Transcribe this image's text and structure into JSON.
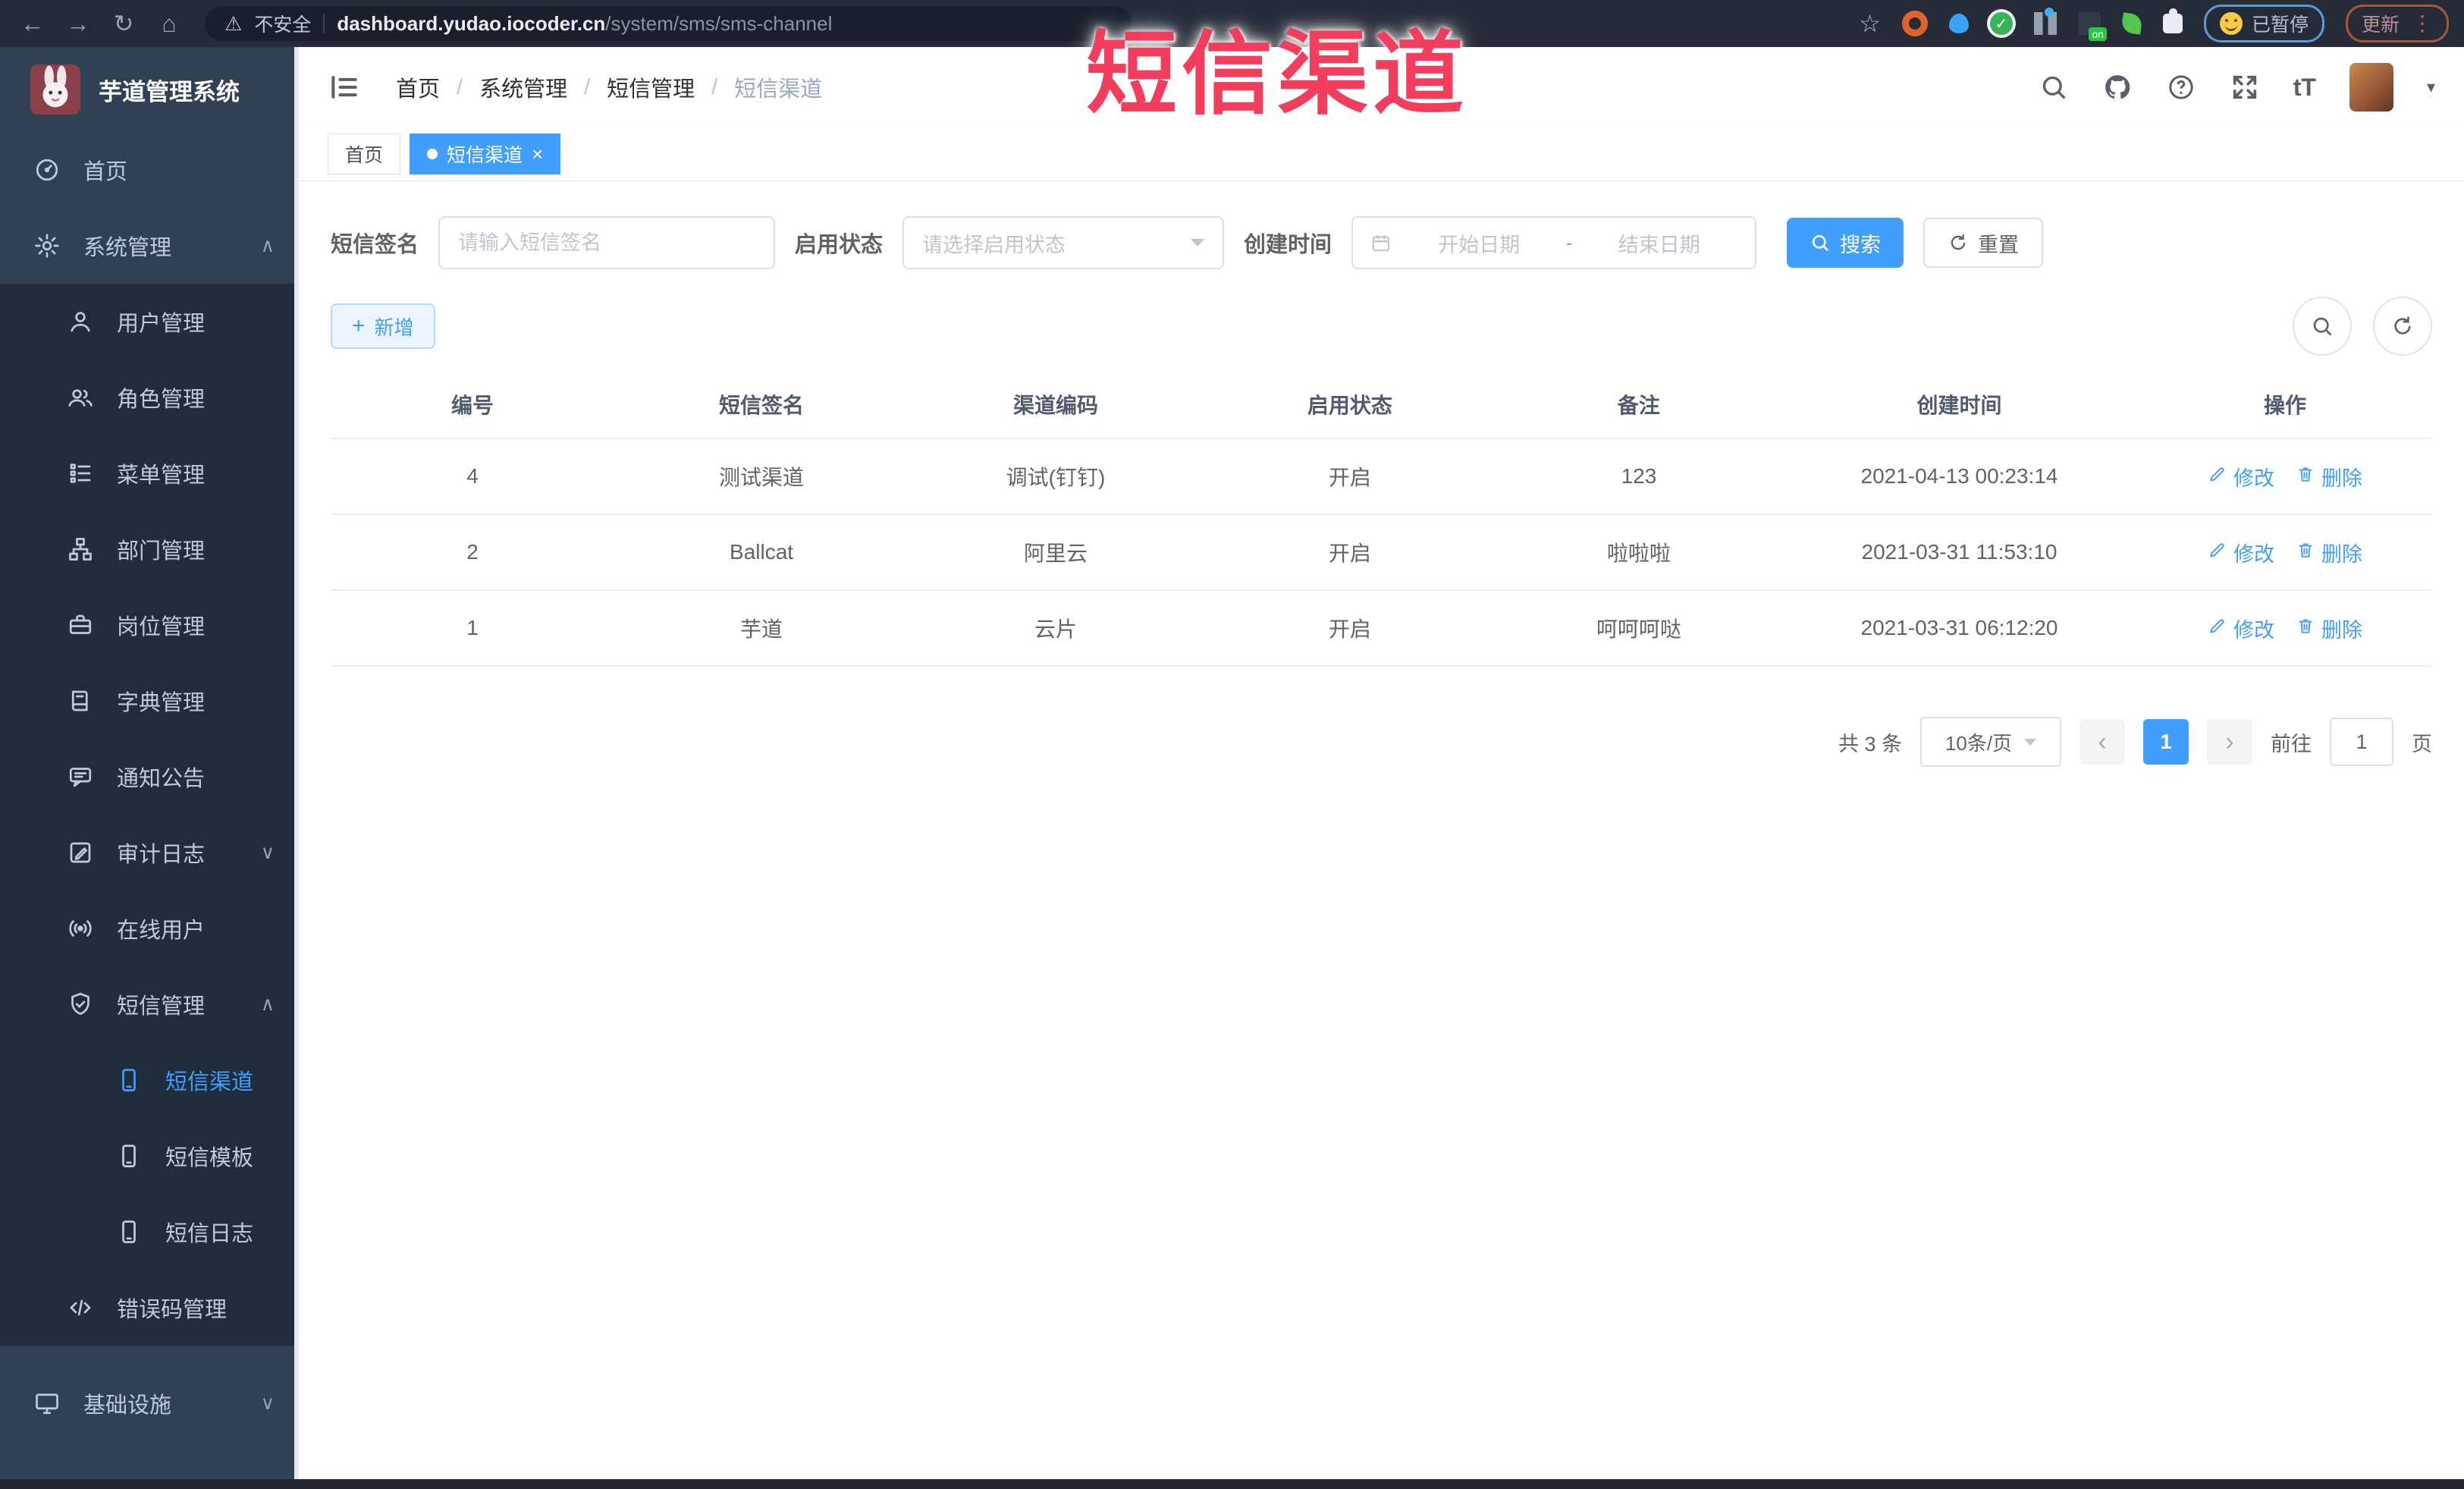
{
  "watermark": "短信渠道",
  "colors": {
    "accent": "#409eff",
    "watermark": "#f23e5c",
    "sidebar_bg": "#304156",
    "submenu_bg": "#1f2d3d"
  },
  "browser": {
    "security_label": "不安全",
    "url_host": "dashboard.yudao.iocoder.cn",
    "url_path": "/system/sms/sms-channel",
    "paused_label": "已暂停",
    "update_label": "更新"
  },
  "sidebar": {
    "app_title": "芋道管理系统",
    "items": [
      {
        "label": "首页",
        "icon": "dashboard-icon"
      },
      {
        "label": "系统管理",
        "icon": "gear-icon",
        "arrow": "up"
      },
      {
        "label": "用户管理",
        "icon": "user-icon",
        "sub": 1
      },
      {
        "label": "角色管理",
        "icon": "users-icon",
        "sub": 1
      },
      {
        "label": "菜单管理",
        "icon": "menu-list-icon",
        "sub": 1
      },
      {
        "label": "部门管理",
        "icon": "org-tree-icon",
        "sub": 1
      },
      {
        "label": "岗位管理",
        "icon": "briefcase-icon",
        "sub": 1
      },
      {
        "label": "字典管理",
        "icon": "dictionary-icon",
        "sub": 1
      },
      {
        "label": "通知公告",
        "icon": "announcement-icon",
        "sub": 1
      },
      {
        "label": "审计日志",
        "icon": "audit-log-icon",
        "sub": 1,
        "arrow": "down"
      },
      {
        "label": "在线用户",
        "icon": "online-users-icon",
        "sub": 1
      },
      {
        "label": "短信管理",
        "icon": "sms-shield-icon",
        "sub": 1,
        "arrow": "up"
      },
      {
        "label": "短信渠道",
        "icon": "phone-icon",
        "sub": 2,
        "active": true
      },
      {
        "label": "短信模板",
        "icon": "phone-icon",
        "sub": 2
      },
      {
        "label": "短信日志",
        "icon": "phone-icon",
        "sub": 2
      },
      {
        "label": "错误码管理",
        "icon": "code-icon",
        "sub": 1
      },
      {
        "label": "基础设施",
        "icon": "monitor-icon",
        "arrow": "down",
        "gap": true
      }
    ]
  },
  "header": {
    "breadcrumb": [
      "首页",
      "系统管理",
      "短信管理",
      "短信渠道"
    ]
  },
  "tabs": [
    {
      "label": "首页"
    },
    {
      "label": "短信渠道",
      "active": true
    }
  ],
  "filters": {
    "sign_label": "短信签名",
    "sign_placeholder": "请输入短信签名",
    "status_label": "启用状态",
    "status_placeholder": "请选择启用状态",
    "time_label": "创建时间",
    "date_start_placeholder": "开始日期",
    "date_sep": "-",
    "date_end_placeholder": "结束日期",
    "search_label": "搜索",
    "reset_label": "重置"
  },
  "toolbar": {
    "add_label": "新增"
  },
  "table": {
    "columns": [
      "编号",
      "短信签名",
      "渠道编码",
      "启用状态",
      "备注",
      "创建时间",
      "操作"
    ],
    "edit_label": "修改",
    "delete_label": "删除",
    "rows": [
      {
        "id": "4",
        "sign": "测试渠道",
        "code": "调试(钉钉)",
        "status": "开启",
        "remark": "123",
        "created": "2021-04-13 00:23:14"
      },
      {
        "id": "2",
        "sign": "Ballcat",
        "code": "阿里云",
        "status": "开启",
        "remark": "啦啦啦",
        "created": "2021-03-31 11:53:10"
      },
      {
        "id": "1",
        "sign": "芋道",
        "code": "云片",
        "status": "开启",
        "remark": "呵呵呵哒",
        "created": "2021-03-31 06:12:20"
      }
    ]
  },
  "pagination": {
    "total_label": "共 3 条",
    "page_size": "10条/页",
    "prev": "‹",
    "next": "›",
    "current_page": "1",
    "goto_label": "前往",
    "goto_value": "1",
    "page_unit": "页"
  }
}
